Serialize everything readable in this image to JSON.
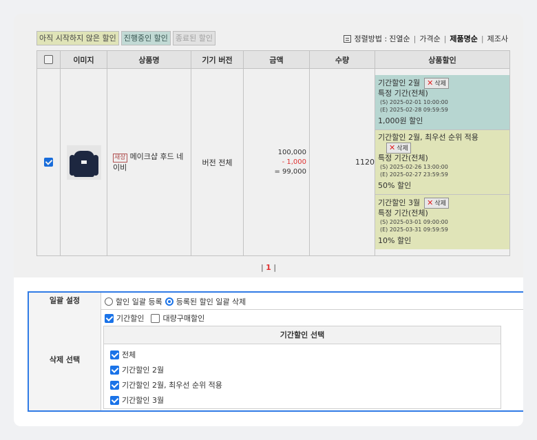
{
  "tabs": [
    {
      "label": "아직 시작하지 않은 할인"
    },
    {
      "label": "진행중인 할인"
    },
    {
      "label": "종료된 할인"
    }
  ],
  "sort": {
    "prefix": "정렬방법 : ",
    "options": [
      "진열순",
      "가격순",
      "제품명순",
      "제조사"
    ],
    "active": "제품명순"
  },
  "table": {
    "headers": [
      "",
      "이미지",
      "상품명",
      "기기 버전",
      "금액",
      "수량",
      "상품할인"
    ],
    "row": {
      "checked": true,
      "badge": "새상",
      "product_name": "메이크샵 후드 네이비",
      "device_version": "버전 전체",
      "price_original": "100,000",
      "price_discount": "- 1,000",
      "price_final": "= 99,000",
      "quantity": "1120",
      "discounts": [
        {
          "title": "기간할인 2월",
          "delete_label": "삭제",
          "scope": "특정 기간(전체)",
          "start": "(S) 2025-02-01 10:00:00",
          "end": "(E) 2025-02-28 09:59:59",
          "amount": "1,000원 할인",
          "color": "#c3e4df"
        },
        {
          "title": "기간할인 2월, 최우선 순위 적용",
          "delete_label": "삭제",
          "scope": "특정 기간(전체)",
          "start": "(S) 2025-02-26 13:00:00",
          "end": "(E) 2025-02-27 23:59:59",
          "amount": "50% 할인",
          "color": "#eef3c4"
        },
        {
          "title": "기간할인 3월",
          "delete_label": "삭제",
          "scope": "특정 기간(전체)",
          "start": "(S) 2025-03-01 09:00:00",
          "end": "(E) 2025-03-31 09:59:59",
          "amount": "10% 할인",
          "color": "#eef3c4"
        }
      ]
    }
  },
  "pager": {
    "left": "| ",
    "current": "1",
    "right": " |"
  },
  "bulk": {
    "label": "일괄 설정",
    "option_register": "할인 일괄 등록",
    "option_delete": "등록된 할인 일괄 삭제",
    "selected": "delete"
  },
  "delete_select": {
    "label": "삭제 선택",
    "period_discount": "기간할인",
    "period_checked": true,
    "bulk_discount": "대량구매할인",
    "bulk_checked": false,
    "sub_title": "기간할인 선택",
    "items": [
      {
        "label": "전체",
        "checked": true
      },
      {
        "label": "기간할인 2월",
        "checked": true
      },
      {
        "label": "기간할인 2월, 최우선 순위 적용",
        "checked": true
      },
      {
        "label": "기간할인 3월",
        "checked": true
      }
    ]
  },
  "colors": {
    "accent": "#2f7ae5",
    "checkbox": "#1a73e8",
    "minus": "#e33"
  }
}
